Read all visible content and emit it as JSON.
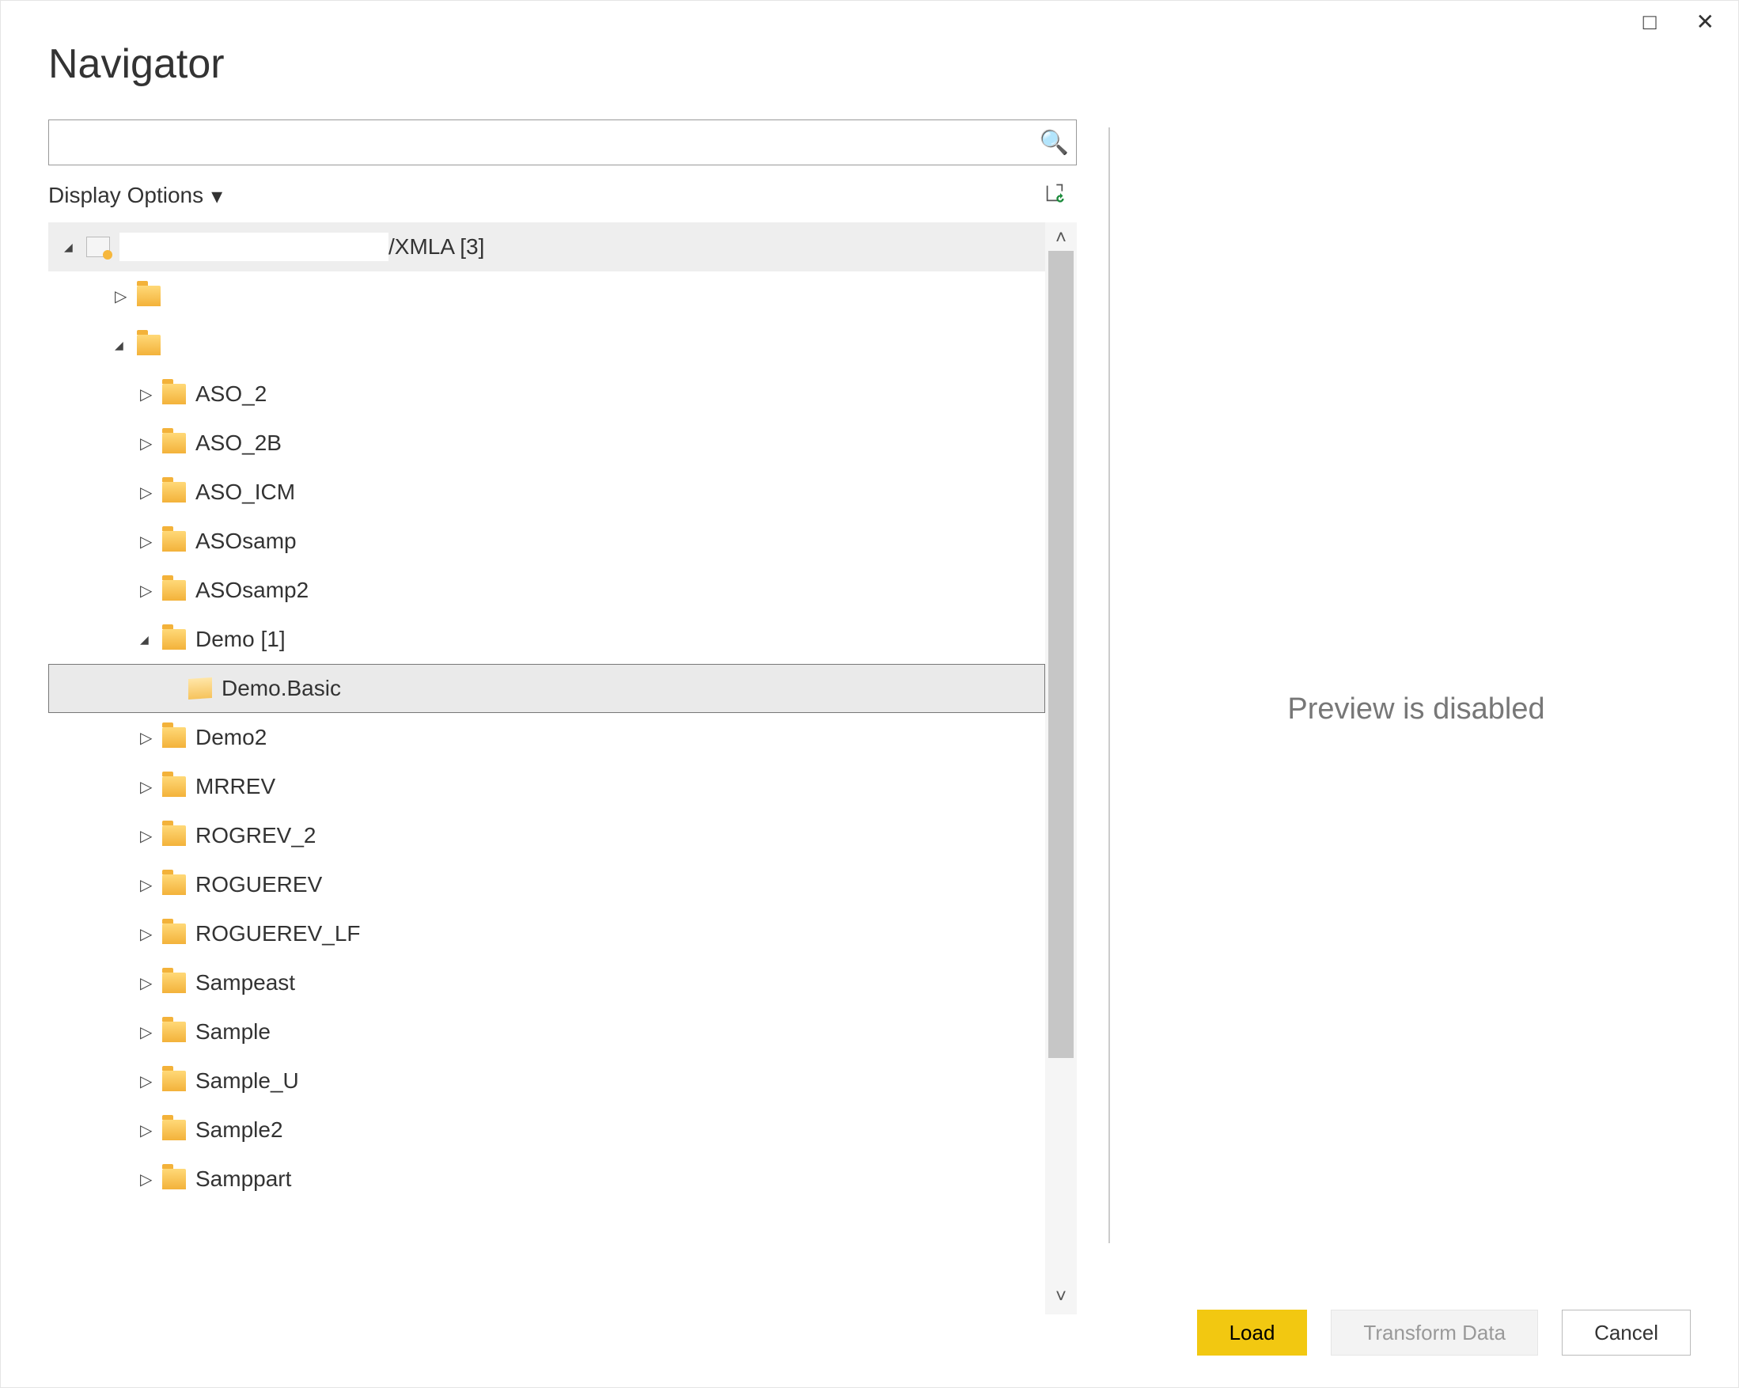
{
  "window": {
    "title": "Navigator",
    "maximize_glyph": "□",
    "close_glyph": "✕"
  },
  "search": {
    "value": "",
    "icon": "🔍"
  },
  "display_options": {
    "label": "Display Options",
    "caret": "▾"
  },
  "tree": {
    "root_label": "/XMLA [3]",
    "items": [
      {
        "label": "",
        "indent": 1,
        "expanded": false,
        "icon": "folder"
      },
      {
        "label": "",
        "indent": 1,
        "expanded": true,
        "icon": "folder"
      },
      {
        "label": "ASO_2",
        "indent": 2,
        "expanded": false,
        "icon": "folder"
      },
      {
        "label": "ASO_2B",
        "indent": 2,
        "expanded": false,
        "icon": "folder"
      },
      {
        "label": "ASO_ICM",
        "indent": 2,
        "expanded": false,
        "icon": "folder"
      },
      {
        "label": "ASOsamp",
        "indent": 2,
        "expanded": false,
        "icon": "folder"
      },
      {
        "label": "ASOsamp2",
        "indent": 2,
        "expanded": false,
        "icon": "folder"
      },
      {
        "label": "Demo [1]",
        "indent": 2,
        "expanded": true,
        "icon": "folder"
      },
      {
        "label": "Demo.Basic",
        "indent": 3,
        "expanded": null,
        "icon": "cube",
        "selected": true
      },
      {
        "label": "Demo2",
        "indent": 2,
        "expanded": false,
        "icon": "folder"
      },
      {
        "label": "MRREV",
        "indent": 2,
        "expanded": false,
        "icon": "folder"
      },
      {
        "label": "ROGREV_2",
        "indent": 2,
        "expanded": false,
        "icon": "folder"
      },
      {
        "label": "ROGUEREV",
        "indent": 2,
        "expanded": false,
        "icon": "folder"
      },
      {
        "label": "ROGUEREV_LF",
        "indent": 2,
        "expanded": false,
        "icon": "folder"
      },
      {
        "label": "Sampeast",
        "indent": 2,
        "expanded": false,
        "icon": "folder"
      },
      {
        "label": "Sample",
        "indent": 2,
        "expanded": false,
        "icon": "folder"
      },
      {
        "label": "Sample_U",
        "indent": 2,
        "expanded": false,
        "icon": "folder"
      },
      {
        "label": "Sample2",
        "indent": 2,
        "expanded": false,
        "icon": "folder"
      },
      {
        "label": "Samppart",
        "indent": 2,
        "expanded": false,
        "icon": "folder"
      }
    ]
  },
  "preview": {
    "message": "Preview is disabled"
  },
  "footer": {
    "load": "Load",
    "transform": "Transform Data",
    "cancel": "Cancel"
  }
}
